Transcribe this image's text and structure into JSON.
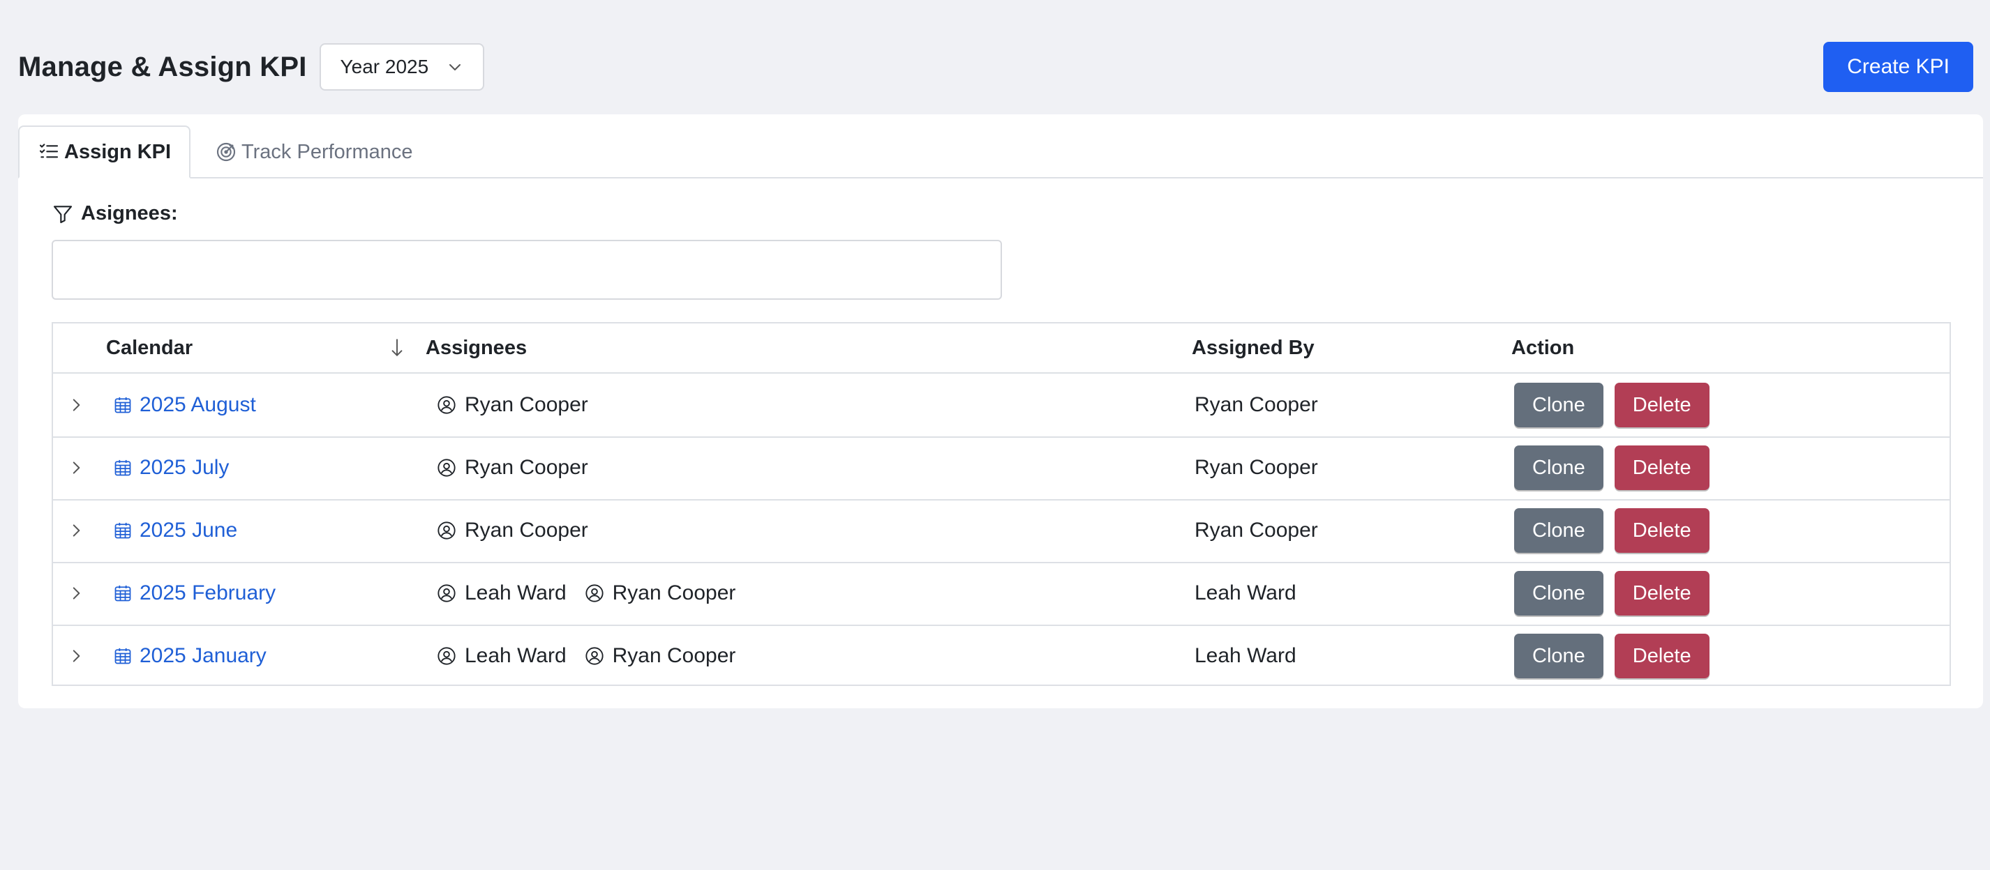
{
  "header": {
    "title": "Manage & Assign KPI",
    "year_select": "Year 2025",
    "create_button": "Create KPI"
  },
  "tabs": [
    {
      "label": "Assign KPI",
      "icon": "list-check-icon",
      "active": true
    },
    {
      "label": "Track Performance",
      "icon": "target-icon",
      "active": false
    }
  ],
  "filter": {
    "label": "Asignees:",
    "icon": "filter-icon",
    "value": ""
  },
  "table": {
    "columns": {
      "calendar": "Calendar",
      "assignees": "Assignees",
      "assigned_by": "Assigned By",
      "action": "Action"
    },
    "sort": {
      "column": "calendar",
      "direction": "descending",
      "icon": "arrow-down-icon"
    },
    "rows": [
      {
        "calendar": "2025 August",
        "assignees": [
          "Ryan Cooper"
        ],
        "assigned_by": "Ryan Cooper"
      },
      {
        "calendar": "2025 July",
        "assignees": [
          "Ryan Cooper"
        ],
        "assigned_by": "Ryan Cooper"
      },
      {
        "calendar": "2025 June",
        "assignees": [
          "Ryan Cooper"
        ],
        "assigned_by": "Ryan Cooper"
      },
      {
        "calendar": "2025 February",
        "assignees": [
          "Leah Ward",
          "Ryan Cooper"
        ],
        "assigned_by": "Leah Ward"
      },
      {
        "calendar": "2025 January",
        "assignees": [
          "Leah Ward",
          "Ryan Cooper"
        ],
        "assigned_by": "Leah Ward"
      }
    ],
    "actions": {
      "clone": "Clone",
      "delete": "Delete"
    }
  },
  "colors": {
    "background": "#f0f1f5",
    "primary": "#1f5ff2",
    "link": "#1f5fd6",
    "clone": "#646f7c",
    "delete": "#b23e55"
  }
}
